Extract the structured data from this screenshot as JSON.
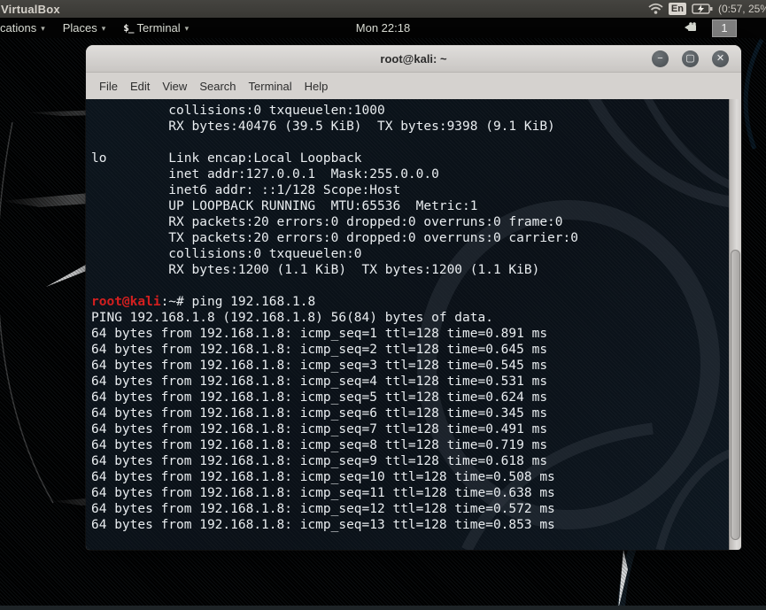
{
  "host": {
    "title": "VirtualBox",
    "keyboard_layout": "En",
    "battery_status": "(0:57, 25%",
    "icons": [
      "wifi-icon",
      "battery-charging-icon"
    ]
  },
  "panel": {
    "applications_label": "cations",
    "places_label": "Places",
    "terminal_label": "Terminal",
    "terminal_icon_glyph": "$_",
    "clock": "Mon 22:18",
    "workspace": "1",
    "caret": "▾"
  },
  "window": {
    "title": "root@kali: ~",
    "controls": {
      "minimize": "−",
      "maximize": "▢",
      "close": "✕"
    },
    "menu_items": [
      "File",
      "Edit",
      "View",
      "Search",
      "Terminal",
      "Help"
    ]
  },
  "terminal": {
    "colors": {
      "background": "#0b141c",
      "foreground": "#e9edf0",
      "prompt_user": "#d41f1f"
    },
    "lines": [
      {
        "t": "plain",
        "text": "          collisions:0 txqueuelen:1000"
      },
      {
        "t": "plain",
        "text": "          RX bytes:40476 (39.5 KiB)  TX bytes:9398 (9.1 KiB)"
      },
      {
        "t": "plain",
        "text": ""
      },
      {
        "t": "plain",
        "text": "lo        Link encap:Local Loopback"
      },
      {
        "t": "plain",
        "text": "          inet addr:127.0.0.1  Mask:255.0.0.0"
      },
      {
        "t": "plain",
        "text": "          inet6 addr: ::1/128 Scope:Host"
      },
      {
        "t": "plain",
        "text": "          UP LOOPBACK RUNNING  MTU:65536  Metric:1"
      },
      {
        "t": "plain",
        "text": "          RX packets:20 errors:0 dropped:0 overruns:0 frame:0"
      },
      {
        "t": "plain",
        "text": "          TX packets:20 errors:0 dropped:0 overruns:0 carrier:0"
      },
      {
        "t": "plain",
        "text": "          collisions:0 txqueuelen:0"
      },
      {
        "t": "plain",
        "text": "          RX bytes:1200 (1.1 KiB)  TX bytes:1200 (1.1 KiB)"
      },
      {
        "t": "plain",
        "text": ""
      },
      {
        "t": "prompt",
        "user": "root@kali",
        "sep": ":~#",
        "cmd": " ping 192.168.1.8"
      },
      {
        "t": "plain",
        "text": "PING 192.168.1.8 (192.168.1.8) 56(84) bytes of data."
      },
      {
        "t": "plain",
        "text": "64 bytes from 192.168.1.8: icmp_seq=1 ttl=128 time=0.891 ms"
      },
      {
        "t": "plain",
        "text": "64 bytes from 192.168.1.8: icmp_seq=2 ttl=128 time=0.645 ms"
      },
      {
        "t": "plain",
        "text": "64 bytes from 192.168.1.8: icmp_seq=3 ttl=128 time=0.545 ms"
      },
      {
        "t": "plain",
        "text": "64 bytes from 192.168.1.8: icmp_seq=4 ttl=128 time=0.531 ms"
      },
      {
        "t": "plain",
        "text": "64 bytes from 192.168.1.8: icmp_seq=5 ttl=128 time=0.624 ms"
      },
      {
        "t": "plain",
        "text": "64 bytes from 192.168.1.8: icmp_seq=6 ttl=128 time=0.345 ms"
      },
      {
        "t": "plain",
        "text": "64 bytes from 192.168.1.8: icmp_seq=7 ttl=128 time=0.491 ms"
      },
      {
        "t": "plain",
        "text": "64 bytes from 192.168.1.8: icmp_seq=8 ttl=128 time=0.719 ms"
      },
      {
        "t": "plain",
        "text": "64 bytes from 192.168.1.8: icmp_seq=9 ttl=128 time=0.618 ms"
      },
      {
        "t": "plain",
        "text": "64 bytes from 192.168.1.8: icmp_seq=10 ttl=128 time=0.508 ms"
      },
      {
        "t": "plain",
        "text": "64 bytes from 192.168.1.8: icmp_seq=11 ttl=128 time=0.638 ms"
      },
      {
        "t": "plain",
        "text": "64 bytes from 192.168.1.8: icmp_seq=12 ttl=128 time=0.572 ms"
      },
      {
        "t": "plain",
        "text": "64 bytes from 192.168.1.8: icmp_seq=13 ttl=128 time=0.853 ms"
      }
    ]
  },
  "wallpaper": {
    "base_blue": "#1d77b5",
    "dark_blue": "#123a56"
  }
}
